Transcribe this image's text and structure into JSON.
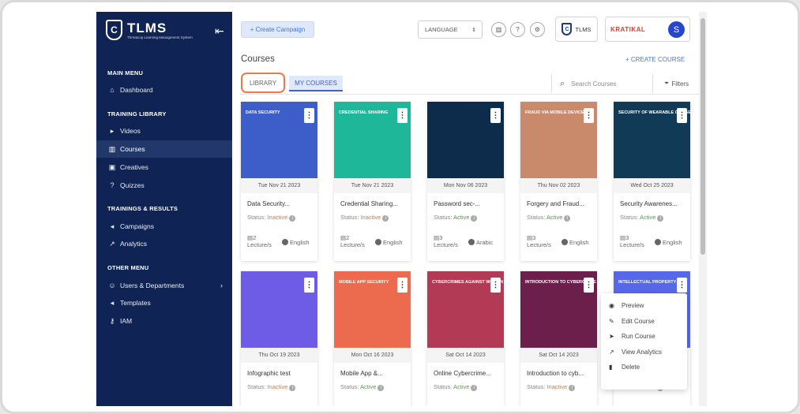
{
  "sidebar": {
    "logo_title": "TLMS",
    "logo_sub": "Threatcop Learning Management System",
    "sections": {
      "main": "MAIN MENU",
      "training": "TRAINING LIBRARY",
      "results": "TRAININGS & RESULTS",
      "other": "OTHER MENU"
    },
    "items": {
      "dashboard": "Dashboard",
      "videos": "Videos",
      "courses": "Courses",
      "creatives": "Creatives",
      "quizzes": "Quizzes",
      "campaigns": "Campaigns",
      "analytics": "Analytics",
      "users": "Users & Departments",
      "templates": "Templates",
      "iam": "IAM"
    }
  },
  "topbar": {
    "create_campaign": "+ Create Campaign",
    "language": "LANGUAGE",
    "brand_tlms": "TLMS",
    "brand_kratikal": "KRATIKAL",
    "avatar_initial": "S"
  },
  "page": {
    "title": "Courses",
    "create_course": "+ CREATE COURSE",
    "tab_library": "LIBRARY",
    "tab_my_courses": "MY COURSES",
    "search_placeholder": "Search Courses",
    "filters": "Filters"
  },
  "courses": [
    {
      "thumb_title": "DATA SECURITY",
      "date": "Tue Nov 21 2023",
      "title": "Data Security...",
      "status": "Inactive",
      "lectures": "2",
      "language": "English",
      "color": "#3d5ec8"
    },
    {
      "thumb_title": "CREDENTIAL SHARING",
      "date": "Tue Nov 21 2023",
      "title": "Credential Sharing...",
      "status": "Inactive",
      "lectures": "2",
      "language": "English",
      "color": "#1fb79a"
    },
    {
      "thumb_title": "",
      "date": "Mon Nov 06 2023",
      "title": "Password sec-...",
      "status": "Active",
      "lectures": "3",
      "language": "Arabic",
      "color": "#0d2b4a"
    },
    {
      "thumb_title": "FRAUD VIA MOBILE DEVICE",
      "date": "Thu Nov 02 2023",
      "title": "Forgery and Fraud...",
      "status": "Active",
      "lectures": "3",
      "language": "English",
      "color": "#c98a6b"
    },
    {
      "thumb_title": "SECURITY OF WEARABLE GADGETS",
      "date": "Wed Oct 25 2023",
      "title": "Security Awarenes...",
      "status": "Active",
      "lectures": "3",
      "language": "English",
      "color": "#103a55"
    },
    {
      "thumb_title": "",
      "date": "Thu Oct 19 2023",
      "title": "Infographic test",
      "status": "Inactive",
      "color": "#6f5ce6"
    },
    {
      "thumb_title": "MOBILE APP SECURITY",
      "date": "Mon Oct 16 2023",
      "title": "Mobile App &...",
      "status": "Active",
      "color": "#ec6b4f"
    },
    {
      "thumb_title": "CYBERCRIMES AGAINST WOMEN",
      "date": "Sat Oct 14 2023",
      "title": "Online Cybercrime...",
      "status": "Active",
      "color": "#b23a55"
    },
    {
      "thumb_title": "INTRODUCTION TO CYBERCRIME",
      "date": "Sat Oct 14 2023",
      "title": "Introduction to cyb...",
      "status": "Inactive",
      "color": "#6b1f4a"
    },
    {
      "thumb_title": "INTELLECTUAL PROPERTY",
      "date": "",
      "title": "",
      "status": "Active",
      "color": "#5668e8"
    }
  ],
  "labels": {
    "status": "Status:",
    "lecture": "Lecture/s"
  },
  "context_menu": [
    "Preview",
    "Edit Course",
    "Run Course",
    "View Analytics",
    "Delete"
  ],
  "context_icons": [
    "eye-icon",
    "edit-icon",
    "send-icon",
    "chart-icon",
    "trash-icon"
  ]
}
